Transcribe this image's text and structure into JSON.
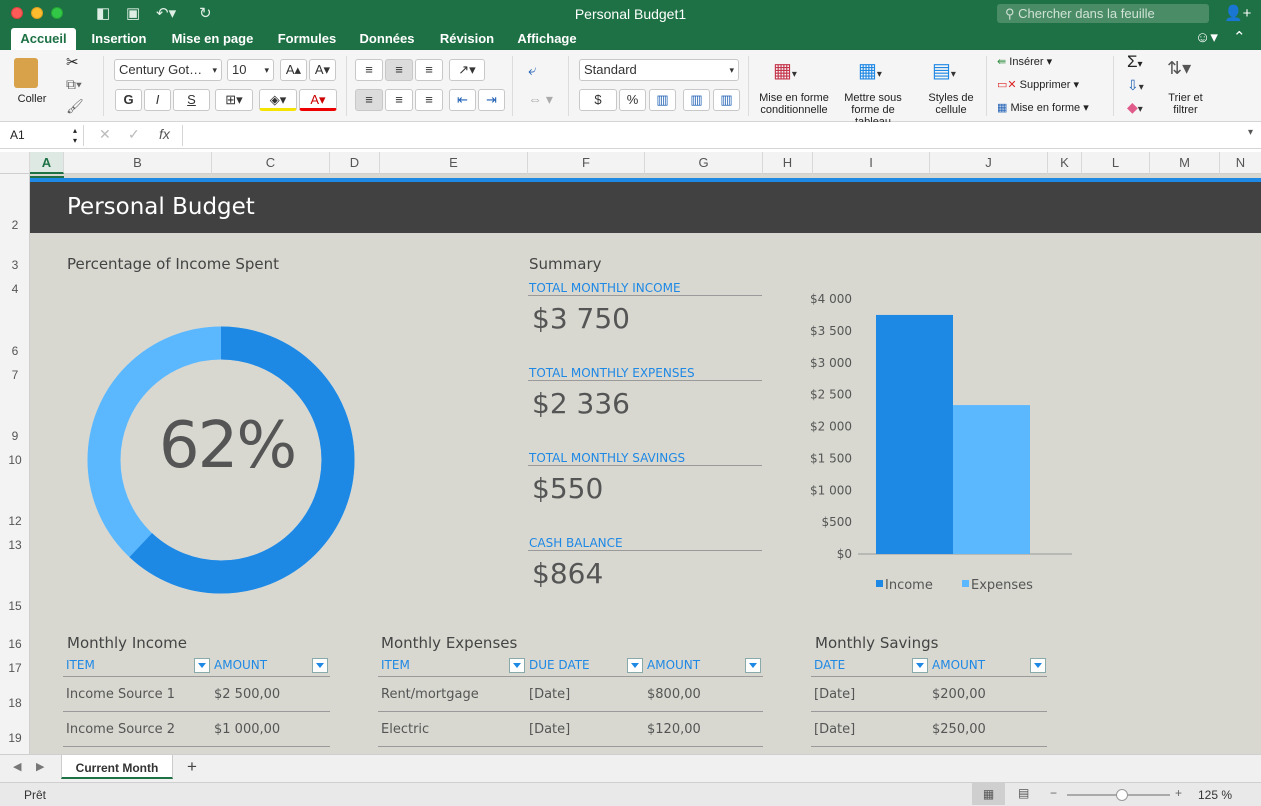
{
  "window": {
    "title": "Personal Budget1",
    "search_placeholder": "Chercher dans la feuille"
  },
  "tabs": [
    "Accueil",
    "Insertion",
    "Mise en page",
    "Formules",
    "Données",
    "Révision",
    "Affichage"
  ],
  "ribbon": {
    "paste_label": "Coller",
    "font_name": "Century Got…",
    "font_size": "10",
    "bold": "G",
    "italic": "I",
    "underline": "S",
    "number_format": "Standard",
    "currency": "$",
    "percent": "%",
    "cond_format": "Mise en forme conditionnelle",
    "format_table": "Mettre sous forme de tableau",
    "cell_styles": "Styles de cellule",
    "insert": "Insérer",
    "delete": "Supprimer",
    "format": "Mise en forme",
    "sort_filter": "Trier et filtrer"
  },
  "formula_bar": {
    "name_box": "A1",
    "fx": "fx",
    "value": ""
  },
  "columns": [
    "A",
    "B",
    "C",
    "D",
    "E",
    "F",
    "G",
    "H",
    "I",
    "J",
    "K",
    "L",
    "M",
    "N"
  ],
  "rows": [
    "2",
    "3",
    "4",
    "6",
    "7",
    "9",
    "10",
    "12",
    "13",
    "15",
    "16",
    "17",
    "18",
    "19"
  ],
  "sheet": {
    "title": "Personal Budget",
    "percent_title": "Percentage of Income Spent",
    "percent_value": "62%",
    "percent_fraction": 0.62,
    "summary_title": "Summary",
    "summary": [
      {
        "label": "TOTAL MONTHLY INCOME",
        "value": "$3 750"
      },
      {
        "label": "TOTAL MONTHLY EXPENSES",
        "value": "$2 336"
      },
      {
        "label": "TOTAL MONTHLY SAVINGS",
        "value": "$550"
      },
      {
        "label": "CASH BALANCE",
        "value": "$864"
      }
    ],
    "income": {
      "title": "Monthly Income",
      "headers": [
        "ITEM",
        "AMOUNT"
      ],
      "rows": [
        [
          "Income Source 1",
          "$2 500,00"
        ],
        [
          "Income Source 2",
          "$1 000,00"
        ]
      ]
    },
    "expenses": {
      "title": "Monthly Expenses",
      "headers": [
        "ITEM",
        "DUE DATE",
        "AMOUNT"
      ],
      "rows": [
        [
          "Rent/mortgage",
          "[Date]",
          "$800,00"
        ],
        [
          "Electric",
          "[Date]",
          "$120,00"
        ]
      ]
    },
    "savings": {
      "title": "Monthly Savings",
      "headers": [
        "DATE",
        "AMOUNT"
      ],
      "rows": [
        [
          "[Date]",
          "$200,00"
        ],
        [
          "[Date]",
          "$250,00"
        ]
      ]
    }
  },
  "chart_data": [
    {
      "type": "pie",
      "title": "Percentage of Income Spent",
      "slices": [
        {
          "value": 62,
          "color": "#1e88e5"
        },
        {
          "value": 38,
          "color": "#5bb8ff"
        }
      ],
      "center_label": "62%"
    },
    {
      "type": "bar",
      "categories": [
        ""
      ],
      "series": [
        {
          "name": "Income",
          "values": [
            3750
          ],
          "color": "#1e88e5"
        },
        {
          "name": "Expenses",
          "values": [
            2336
          ],
          "color": "#5bb8ff"
        }
      ],
      "ylim": [
        0,
        4000
      ],
      "yticks": [
        "$0",
        "$500",
        "$1 000",
        "$1 500",
        "$2 000",
        "$2 500",
        "$3 000",
        "$3 500",
        "$4 000"
      ],
      "legend": "bottom"
    }
  ],
  "sheet_tabs": [
    "Current Month"
  ],
  "status": {
    "text": "Prêt",
    "zoom": "125 %"
  },
  "colors": {
    "ribbon_green": "#1e7145",
    "accent": "#1e88e5",
    "light_accent": "#5bb8ff",
    "banner": "#414141",
    "sheet_bg": "#d8d8d1"
  }
}
